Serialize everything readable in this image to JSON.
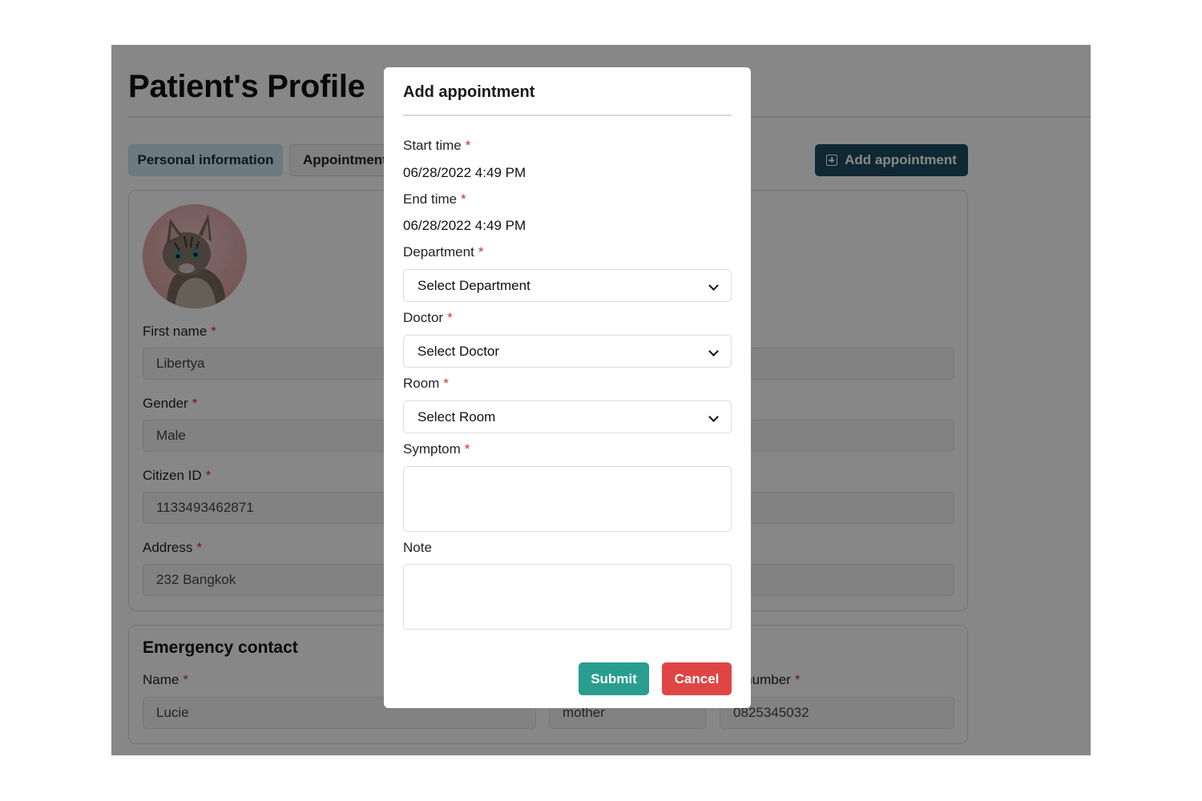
{
  "page": {
    "title": "Patient's Profile",
    "tabs": [
      {
        "label": "Personal information",
        "active": true
      },
      {
        "label": "Appointment",
        "active": false
      }
    ],
    "add_appointment_label": "Add appointment"
  },
  "personal": {
    "first_name_label": "First name",
    "first_name_value": "Libertya",
    "gender_label": "Gender",
    "gender_value": "Male",
    "citizen_id_label": "Citizen ID",
    "citizen_id_value": "1133493462871",
    "address_label": "Address",
    "address_value": "232 Bangkok"
  },
  "emergency": {
    "heading": "Emergency contact",
    "name_label": "Name",
    "name_value": "Lucie",
    "relationship_value": "mother",
    "phone_label_partial": "e number",
    "phone_value": "0825345032"
  },
  "modal": {
    "title": "Add appointment",
    "start_time_label": "Start time",
    "start_time_value": "06/28/2022 4:49 PM",
    "end_time_label": "End time",
    "end_time_value": "06/28/2022 4:49 PM",
    "department_label": "Department",
    "department_value": "Select Department",
    "doctor_label": "Doctor",
    "doctor_value": "Select Doctor",
    "room_label": "Room",
    "room_value": "Select Room",
    "symptom_label": "Symptom",
    "note_label": "Note",
    "submit_label": "Submit",
    "cancel_label": "Cancel",
    "required_mark": "*"
  },
  "colors": {
    "primary_dark": "#1d4d61",
    "tab_active_bg": "#cfe6f3",
    "submit": "#2a9d8f",
    "cancel": "#e04545",
    "required": "#d32f2f"
  }
}
